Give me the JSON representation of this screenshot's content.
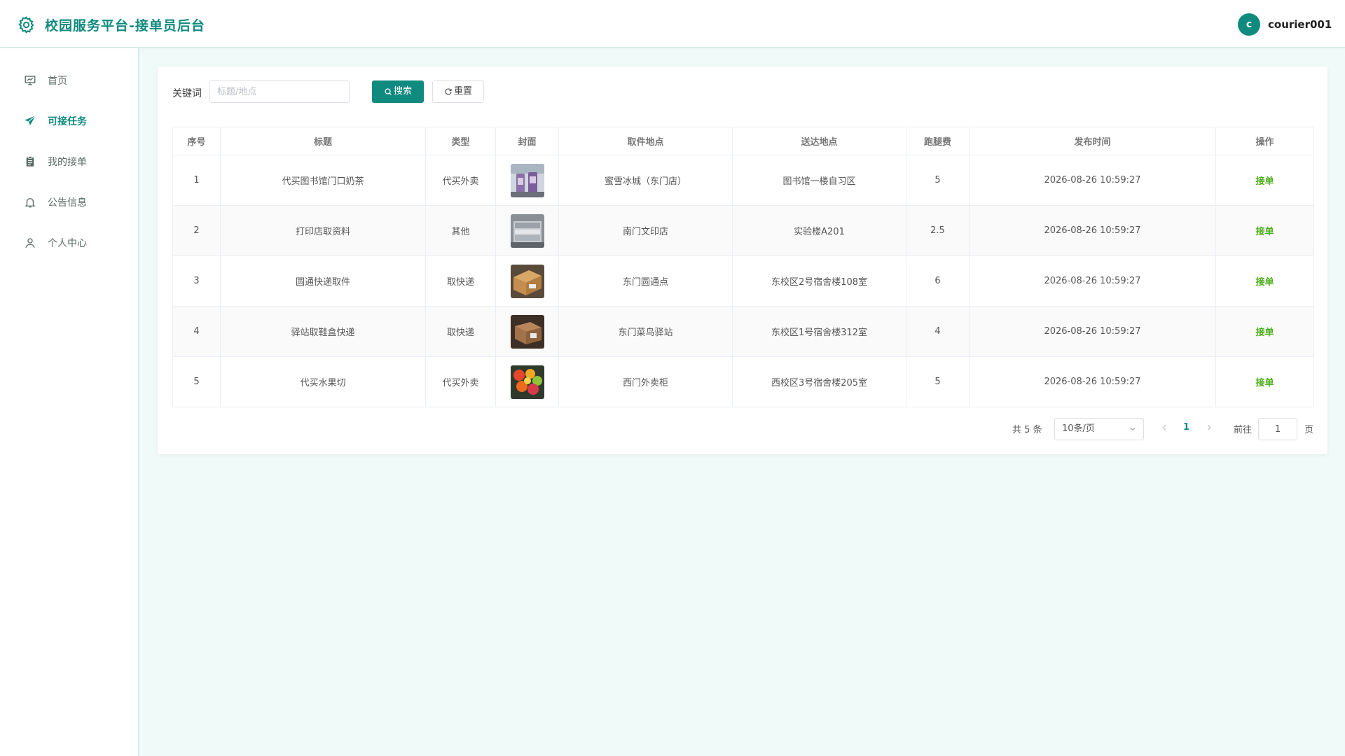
{
  "header": {
    "title": "校园服务平台-接单员后台",
    "avatar_letter": "c",
    "username": "courier001"
  },
  "sidebar": {
    "items": [
      {
        "label": "首页",
        "icon": "presentation-icon"
      },
      {
        "label": "可接任务",
        "icon": "send-icon",
        "active": true
      },
      {
        "label": "我的接单",
        "icon": "clipboard-icon"
      },
      {
        "label": "公告信息",
        "icon": "bell-icon"
      },
      {
        "label": "个人中心",
        "icon": "user-icon"
      }
    ]
  },
  "search": {
    "keyword_label": "关键词",
    "placeholder": "标题/地点",
    "value": "",
    "search_label": "搜索",
    "reset_label": "重置"
  },
  "table": {
    "columns": [
      "序号",
      "标题",
      "类型",
      "封面",
      "取件地点",
      "送达地点",
      "跑腿费",
      "发布时间",
      "操作"
    ],
    "rows": [
      {
        "index": "1",
        "title": "代买图书馆门口奶茶",
        "type": "代买外卖",
        "cover": "milk-tea-image",
        "pickup": "蜜雪冰城（东门店）",
        "dropoff": "图书馆一楼自习区",
        "fee": "5",
        "time": "2026-08-26 10:59:27",
        "action": "接单"
      },
      {
        "index": "2",
        "title": "打印店取资料",
        "type": "其他",
        "cover": "printed-papers-image",
        "pickup": "南门文印店",
        "dropoff": "实验楼A201",
        "fee": "2.5",
        "time": "2026-08-26 10:59:27",
        "action": "接单"
      },
      {
        "index": "3",
        "title": "圆通快递取件",
        "type": "取快递",
        "cover": "parcel-box-image",
        "pickup": "东门圆通点",
        "dropoff": "东校区2号宿舍楼108室",
        "fee": "6",
        "time": "2026-08-26 10:59:27",
        "action": "接单"
      },
      {
        "index": "4",
        "title": "驿站取鞋盒快递",
        "type": "取快递",
        "cover": "shoe-box-image",
        "pickup": "东门菜鸟驿站",
        "dropoff": "东校区1号宿舍楼312室",
        "fee": "4",
        "time": "2026-08-26 10:59:27",
        "action": "接单"
      },
      {
        "index": "5",
        "title": "代买水果切",
        "type": "代买外卖",
        "cover": "fruit-cup-image",
        "pickup": "西门外卖柜",
        "dropoff": "西校区3号宿舍楼205室",
        "fee": "5",
        "time": "2026-08-26 10:59:27",
        "action": "接单"
      }
    ]
  },
  "pagination": {
    "total_text": "共 5 条",
    "page_size": "10条/页",
    "current_page": "1",
    "goto_label": "前往",
    "goto_value": "1",
    "page_unit": "页"
  },
  "colors": {
    "accent": "#0f8a7e",
    "action_green": "#4cae1a",
    "page_bg": "#f0faf8"
  }
}
